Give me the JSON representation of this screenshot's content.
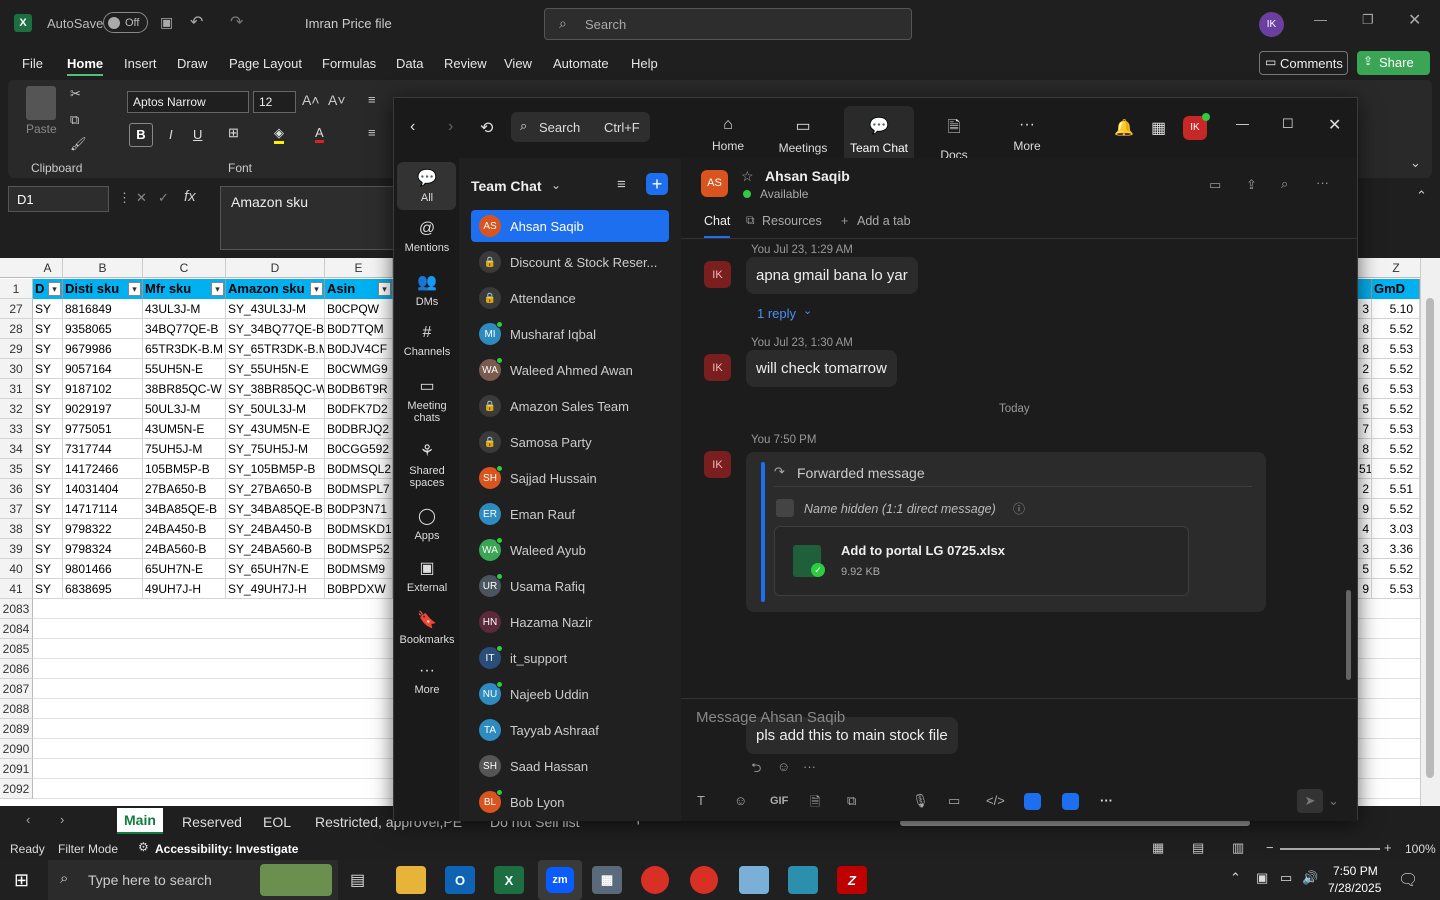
{
  "excel": {
    "autosave_label": "AutoSave",
    "autosave_state": "Off",
    "file_title": "Imran Price file",
    "search_placeholder": "Search",
    "user_initials": "IK",
    "menu": [
      "File",
      "Home",
      "Insert",
      "Draw",
      "Page Layout",
      "Formulas",
      "Data",
      "Review",
      "View",
      "Automate",
      "Help"
    ],
    "comments_label": "Comments",
    "share_label": "Share",
    "font_name": "Aptos Narrow",
    "font_size": "12",
    "paste_label": "Paste",
    "clipboard_label": "Clipboard",
    "font_group_label": "Font",
    "name_box": "D1",
    "formula_value": "Amazon sku",
    "columns": [
      "A",
      "B",
      "C",
      "D",
      "E",
      "Z"
    ],
    "headers": [
      "D",
      "Disti sku",
      "Mfr sku",
      "Amazon sku",
      "Asin",
      "GmD"
    ],
    "rows": [
      {
        "n": "27",
        "a": "SY",
        "b": "8816849",
        "c": "43UL3J-M",
        "d": "SY_43UL3J-M",
        "e": "B0CPQW",
        "z": "5.10",
        "y": "3"
      },
      {
        "n": "28",
        "a": "SY",
        "b": "9358065",
        "c": "34BQ77QE-B",
        "d": "SY_34BQ77QE-B",
        "e": "B0D7TQM",
        "z": "5.52",
        "y": "8"
      },
      {
        "n": "29",
        "a": "SY",
        "b": "9679986",
        "c": "65TR3DK-B.M",
        "d": "SY_65TR3DK-B.M",
        "e": "B0DJV4CF",
        "z": "5.53",
        "y": "8"
      },
      {
        "n": "30",
        "a": "SY",
        "b": "9057164",
        "c": "55UH5N-E",
        "d": "SY_55UH5N-E",
        "e": "B0CWMG9",
        "z": "5.52",
        "y": "2"
      },
      {
        "n": "31",
        "a": "SY",
        "b": "9187102",
        "c": "38BR85QC-W",
        "d": "SY_38BR85QC-W",
        "e": "B0DB6T9R",
        "z": "5.53",
        "y": "6"
      },
      {
        "n": "32",
        "a": "SY",
        "b": "9029197",
        "c": "50UL3J-M",
        "d": "SY_50UL3J-M",
        "e": "B0DFK7D2",
        "z": "5.52",
        "y": "5"
      },
      {
        "n": "33",
        "a": "SY",
        "b": "9775051",
        "c": "43UM5N-E",
        "d": "SY_43UM5N-E",
        "e": "B0DBRJQ2",
        "z": "5.53",
        "y": "7"
      },
      {
        "n": "34",
        "a": "SY",
        "b": "7317744",
        "c": "75UH5J-M",
        "d": "SY_75UH5J-M",
        "e": "B0CGG592",
        "z": "5.52",
        "y": "8"
      },
      {
        "n": "35",
        "a": "SY",
        "b": "14172466",
        "c": "105BM5P-B",
        "d": "SY_105BM5P-B",
        "e": "B0DMSQL2",
        "z": "5.52",
        "y": "51"
      },
      {
        "n": "36",
        "a": "SY",
        "b": "14031404",
        "c": "27BA650-B",
        "d": "SY_27BA650-B",
        "e": "B0DMSPL7",
        "z": "5.51",
        "y": "2"
      },
      {
        "n": "37",
        "a": "SY",
        "b": "14717114",
        "c": "34BA85QE-B",
        "d": "SY_34BA85QE-B",
        "e": "B0DP3N71",
        "z": "5.52",
        "y": "9"
      },
      {
        "n": "38",
        "a": "SY",
        "b": "9798322",
        "c": "24BA450-B",
        "d": "SY_24BA450-B",
        "e": "B0DMSKD1",
        "z": "3.03",
        "y": "4"
      },
      {
        "n": "39",
        "a": "SY",
        "b": "9798324",
        "c": "24BA560-B",
        "d": "SY_24BA560-B",
        "e": "B0DMSP52",
        "z": "3.36",
        "y": "3"
      },
      {
        "n": "40",
        "a": "SY",
        "b": "9801466",
        "c": "65UH7N-E",
        "d": "SY_65UH7N-E",
        "e": "B0DMSM9",
        "z": "5.52",
        "y": "5"
      },
      {
        "n": "41",
        "a": "SY",
        "b": "6838695",
        "c": "49UH7J-H",
        "d": "SY_49UH7J-H",
        "e": "B0BPDXW",
        "z": "5.53",
        "y": "9"
      }
    ],
    "empty_rows": [
      "2083",
      "2084",
      "2085",
      "2086",
      "2087",
      "2088",
      "2089",
      "2090",
      "2091",
      "2092"
    ],
    "sheet_tabs": [
      "Main",
      "Reserved",
      "EOL",
      "Restricted, approvel,PE",
      "Do not Sell list"
    ],
    "status": {
      "ready": "Ready",
      "filter": "Filter Mode",
      "accessibility": "Accessibility: Investigate",
      "zoom": "100%"
    }
  },
  "zoom": {
    "search_label": "Search",
    "search_shortcut": "Ctrl+F",
    "nav": [
      "Home",
      "Meetings",
      "Team Chat",
      "Docs",
      "More"
    ],
    "user_initials": "IK",
    "rail": [
      "All",
      "Mentions",
      "DMs",
      "Channels",
      "Meeting chats",
      "Shared spaces",
      "Apps",
      "External",
      "Bookmarks",
      "More"
    ],
    "list_title": "Team Chat",
    "contacts": [
      {
        "name": "Ahsan Saqib",
        "initials": "AS",
        "color": "#d9541e",
        "active": true,
        "online": false
      },
      {
        "name": "Discount & Stock Reser...",
        "initials": "🔒",
        "color": "#3a3a3a",
        "active": false,
        "online": false
      },
      {
        "name": "Attendance",
        "initials": "🔒",
        "color": "#3a3a3a",
        "active": false,
        "online": false
      },
      {
        "name": "Musharaf Iqbal",
        "initials": "MI",
        "color": "#2e8bc0",
        "active": false,
        "online": true
      },
      {
        "name": "Waleed Ahmed Awan",
        "initials": "WA",
        "color": "#7a5c4f",
        "active": false,
        "online": true
      },
      {
        "name": "Amazon Sales Team",
        "initials": "🔒",
        "color": "#3a3a3a",
        "active": false,
        "online": false
      },
      {
        "name": "Samosa Party",
        "initials": "🔒",
        "color": "#3a3a3a",
        "active": false,
        "online": false
      },
      {
        "name": "Sajjad Hussain",
        "initials": "SH",
        "color": "#d9541e",
        "active": false,
        "online": true
      },
      {
        "name": "Eman Rauf",
        "initials": "ER",
        "color": "#2e8bc0",
        "active": false,
        "online": false
      },
      {
        "name": "Waleed Ayub",
        "initials": "WA",
        "color": "#3aa655",
        "active": false,
        "online": true
      },
      {
        "name": "Usama Rafiq",
        "initials": "UR",
        "color": "#4a5560",
        "active": false,
        "online": true
      },
      {
        "name": "Hazama Nazir",
        "initials": "HN",
        "color": "#5a2a3a",
        "active": false,
        "online": false
      },
      {
        "name": "it_support",
        "initials": "IT",
        "color": "#2a4d7a",
        "active": false,
        "online": true
      },
      {
        "name": "Najeeb Uddin",
        "initials": "NU",
        "color": "#2e8bc0",
        "active": false,
        "online": true
      },
      {
        "name": "Tayyab Ashraaf",
        "initials": "TA",
        "color": "#2e8bc0",
        "active": false,
        "online": false
      },
      {
        "name": "Saad Hassan",
        "initials": "SH",
        "color": "#555",
        "active": false,
        "online": false
      },
      {
        "name": "Bob Lyon",
        "initials": "BL",
        "color": "#d9541e",
        "active": false,
        "online": true
      }
    ],
    "chat": {
      "name": "Ahsan Saqib",
      "initials": "AS",
      "status": "Available",
      "tabs": [
        "Chat",
        "Resources",
        "Add a tab"
      ],
      "msg1_meta": "You Jul 23, 1:29 AM",
      "msg1": "apna gmail bana lo yar",
      "reply_count": "1 reply",
      "msg2_meta": "You Jul 23, 1:30 AM",
      "msg2": "will check tomarrow",
      "divider": "Today",
      "msg3_meta": "You 7:50 PM",
      "forwarded": "Forwarded message",
      "hidden_name": "Name hidden (1:1 direct message)",
      "file_name": "Add to portal LG 0725.xlsx",
      "file_size": "9.92 KB",
      "msg4": "pls add this to main stock file",
      "composer_placeholder": "Message Ahsan Saqib"
    }
  },
  "taskbar": {
    "search_placeholder": "Type here to search",
    "time": "7:50 PM",
    "date": "7/28/2025"
  }
}
